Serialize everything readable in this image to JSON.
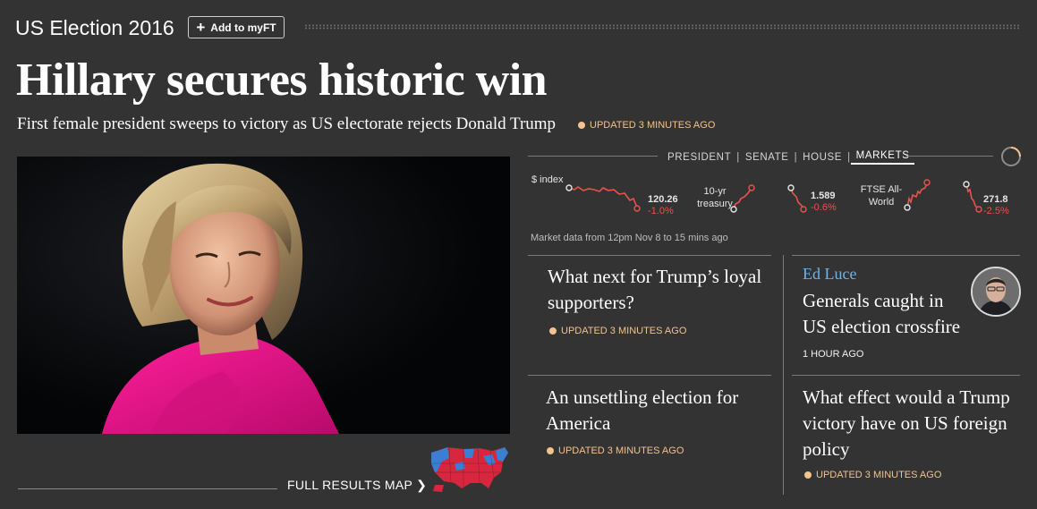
{
  "header": {
    "section_title": "US Election 2016",
    "myft_label": "Add to myFT"
  },
  "lead": {
    "headline": "Hillary secures historic win",
    "standfirst": "First female president sweeps to victory as US electorate rejects Donald Trump",
    "updated": "UPDATED 3 MINUTES AGO"
  },
  "map_link": "FULL RESULTS MAP ❯",
  "tabs": [
    {
      "label": "PRESIDENT",
      "active": false
    },
    {
      "label": "SENATE",
      "active": false
    },
    {
      "label": "HOUSE",
      "active": false
    },
    {
      "label": "MARKETS",
      "active": true
    }
  ],
  "markets": [
    {
      "label": "$ index",
      "value": "120.26",
      "change": "-1.0%"
    },
    {
      "label": "10-yr treasury",
      "value": "1.589",
      "change": "-0.6%"
    },
    {
      "label": "FTSE All-World",
      "value": "271.8",
      "change": "-2.5%"
    }
  ],
  "market_note": "Market data from 12pm Nov 8 to 15 mins ago",
  "stories": [
    {
      "headline": "What next for Trump’s loyal supporters?",
      "meta": "UPDATED 3 MINUTES AGO"
    },
    {
      "author": "Ed Luce",
      "headline": "Generals caught in US election crossfire",
      "meta": "1 HOUR AGO"
    },
    {
      "headline": "An unsettling election for America",
      "meta": "UPDATED 3 MINUTES AGO"
    },
    {
      "headline": "What effect would a Trump victory have on US foreign policy",
      "meta": "UPDATED 3 MINUTES AGO"
    }
  ],
  "colors": {
    "background": "#333333",
    "accent_updated": "#f2c28f",
    "negative": "#e8534a",
    "author": "#6fb4e8",
    "map_red": "#d7263d",
    "map_blue": "#3a7fd5"
  }
}
